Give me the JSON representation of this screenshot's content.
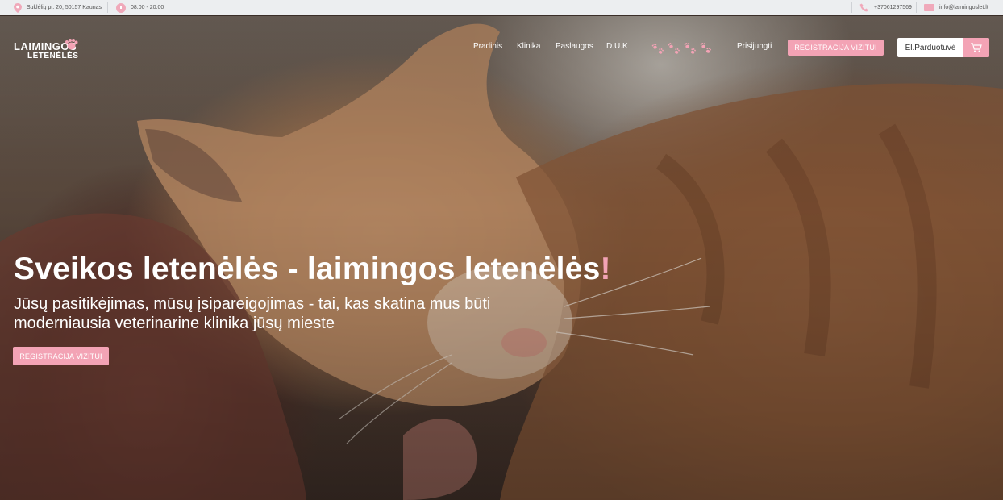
{
  "topbar": {
    "address": "Suklėlių pr. 20, 50157 Kaunas",
    "hours": "08:00 - 20:00",
    "phone": "+37061297569",
    "email": "info@laimingoslet.lt"
  },
  "logo": {
    "line1": "LAIMINGOS",
    "line2": "LETENĖLĖS"
  },
  "nav": {
    "items": [
      "Pradinis",
      "Klinika",
      "Paslaugos",
      "D.U.K"
    ],
    "login": "Prisijungti",
    "register_button": "Registracija vizitui",
    "shop_label": "El.Parduotuvė"
  },
  "hero": {
    "title": "Sveikos letenėlės - laimingos letenėlės",
    "title_accent": "!",
    "subtitle": "Jūsų pasitikėjimas, mūsų įsipareigojimas - tai, kas skatina mus būti moderniausia veterinarine klinika jūsų mieste",
    "cta": "Registracija vizitui"
  },
  "icons": {
    "address": "map-pin-icon",
    "hours": "clock-icon",
    "phone": "phone-icon",
    "email": "mail-icon",
    "shop": "cart-icon",
    "decor": "paw-prints-icon"
  },
  "colors": {
    "accent": "#f3a3b5",
    "topbar_bg": "#eceef0",
    "text_light": "#ffffff"
  }
}
